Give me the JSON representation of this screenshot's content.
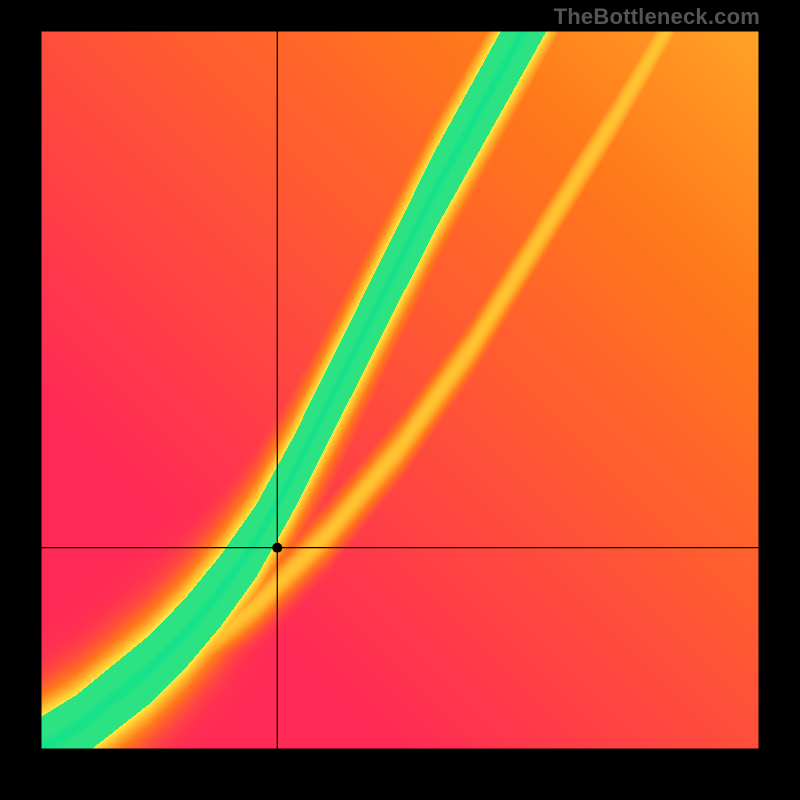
{
  "watermark": "TheBottleneck.com",
  "colors": {
    "black": "#000000",
    "crosshair": "#000000"
  },
  "chart_data": {
    "type": "heatmap",
    "title": "",
    "xlabel": "",
    "ylabel": "",
    "xlim": [
      0,
      1
    ],
    "ylim": [
      0,
      1
    ],
    "point": {
      "x": 0.33,
      "y": 0.28
    },
    "curve_main": [
      [
        0.0,
        0.0
      ],
      [
        0.05,
        0.03
      ],
      [
        0.1,
        0.07
      ],
      [
        0.15,
        0.11
      ],
      [
        0.2,
        0.16
      ],
      [
        0.25,
        0.22
      ],
      [
        0.3,
        0.29
      ],
      [
        0.35,
        0.38
      ],
      [
        0.4,
        0.48
      ],
      [
        0.45,
        0.58
      ],
      [
        0.5,
        0.68
      ],
      [
        0.55,
        0.78
      ],
      [
        0.6,
        0.87
      ],
      [
        0.65,
        0.96
      ],
      [
        0.7,
        1.05
      ]
    ],
    "curve_secondary": [
      [
        0.0,
        0.0
      ],
      [
        0.1,
        0.05
      ],
      [
        0.2,
        0.12
      ],
      [
        0.3,
        0.2
      ],
      [
        0.4,
        0.3
      ],
      [
        0.5,
        0.42
      ],
      [
        0.6,
        0.56
      ],
      [
        0.7,
        0.72
      ],
      [
        0.8,
        0.88
      ],
      [
        0.9,
        1.05
      ]
    ],
    "curve_main_width": 0.05,
    "curve_secondary_width": 0.02,
    "grid": false
  }
}
